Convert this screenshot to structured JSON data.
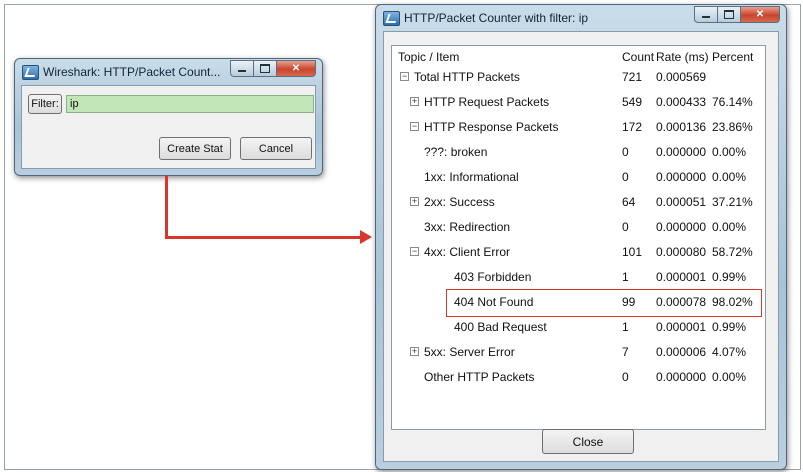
{
  "filter_dialog": {
    "title": "Wireshark: HTTP/Packet Count...",
    "filter_label": "Filter:",
    "filter_value": "ip",
    "create_stat_label": "Create Stat",
    "cancel_label": "Cancel"
  },
  "counter_window": {
    "title": "HTTP/Packet Counter with filter: ip",
    "columns": [
      "Topic / Item",
      "Count",
      "Rate (ms)",
      "Percent"
    ],
    "rows": [
      {
        "topic": "Total HTTP Packets",
        "count": "721",
        "rate": "0.000569",
        "percent": "",
        "depth": 0,
        "expander": "minus"
      },
      {
        "topic": "HTTP Request Packets",
        "count": "549",
        "rate": "0.000433",
        "percent": "76.14%",
        "depth": 1,
        "expander": "plus"
      },
      {
        "topic": "HTTP Response Packets",
        "count": "172",
        "rate": "0.000136",
        "percent": "23.86%",
        "depth": 1,
        "expander": "minus"
      },
      {
        "topic": "???: broken",
        "count": "0",
        "rate": "0.000000",
        "percent": "0.00%",
        "depth": 2,
        "expander": "none"
      },
      {
        "topic": "1xx: Informational",
        "count": "0",
        "rate": "0.000000",
        "percent": "0.00%",
        "depth": 2,
        "expander": "none"
      },
      {
        "topic": "2xx: Success",
        "count": "64",
        "rate": "0.000051",
        "percent": "37.21%",
        "depth": 2,
        "expander": "plus"
      },
      {
        "topic": "3xx: Redirection",
        "count": "0",
        "rate": "0.000000",
        "percent": "0.00%",
        "depth": 2,
        "expander": "none"
      },
      {
        "topic": "4xx: Client Error",
        "count": "101",
        "rate": "0.000080",
        "percent": "58.72%",
        "depth": 2,
        "expander": "minus"
      },
      {
        "topic": "403 Forbidden",
        "count": "1",
        "rate": "0.000001",
        "percent": "0.99%",
        "depth": 3,
        "expander": "none"
      },
      {
        "topic": "404 Not Found",
        "count": "99",
        "rate": "0.000078",
        "percent": "98.02%",
        "depth": 3,
        "expander": "none",
        "highlighted": true
      },
      {
        "topic": "400 Bad Request",
        "count": "1",
        "rate": "0.000001",
        "percent": "0.99%",
        "depth": 3,
        "expander": "none"
      },
      {
        "topic": "5xx: Server Error",
        "count": "7",
        "rate": "0.000006",
        "percent": "4.07%",
        "depth": 2,
        "expander": "plus"
      },
      {
        "topic": "Other HTTP Packets",
        "count": "0",
        "rate": "0.000000",
        "percent": "0.00%",
        "depth": 1,
        "expander": "none"
      }
    ],
    "close_label": "Close"
  },
  "colors": {
    "highlight_border": "#d2372a",
    "arrow": "#d8362a",
    "filter_valid_bg": "#c3e6b8"
  },
  "icons": {
    "app": "wireshark-app-icon",
    "window_controls": [
      "minimize-icon",
      "maximize-icon",
      "close-icon"
    ],
    "tree": [
      "tree-expand-icon",
      "tree-collapse-icon"
    ]
  }
}
